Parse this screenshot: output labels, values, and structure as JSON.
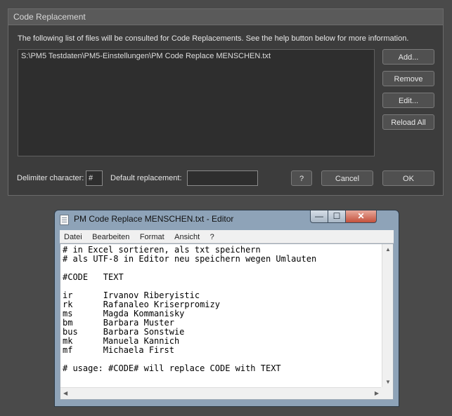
{
  "dialog": {
    "title": "Code Replacement",
    "intro": "The following list of files will be consulted for Code Replacements.  See the help button below for more information.",
    "files": [
      "S:\\PM5 Testdaten\\PM5-Einstellungen\\PM Code Replace MENSCHEN.txt"
    ],
    "buttons": {
      "add": "Add...",
      "remove": "Remove",
      "edit": "Edit...",
      "reload_all": "Reload All",
      "help": "?",
      "cancel": "Cancel",
      "ok": "OK"
    },
    "delimiter_label": "Delimiter character:",
    "delimiter_value": "#",
    "default_replacement_label": "Default replacement:",
    "default_replacement_value": ""
  },
  "notepad": {
    "title": "PM Code Replace MENSCHEN.txt - Editor",
    "controls": {
      "minimize": "—",
      "maximize": "☐",
      "close": "✕"
    },
    "menu": [
      "Datei",
      "Bearbeiten",
      "Format",
      "Ansicht",
      "?"
    ],
    "content": "# in Excel sortieren, als txt speichern\n# als UTF-8 in Editor neu speichern wegen Umlauten\n\n#CODE   TEXT\n\nir      Irvanov Riberyistic\nrk      Rafanaleo Kriserpromizy\nms      Magda Kommanisky\nbm      Barbara Muster\nbus     Barbara Sonstwie\nmk      Manuela Kannich\nmf      Michaela First\n\n# usage: #CODE# will replace CODE with TEXT"
  }
}
